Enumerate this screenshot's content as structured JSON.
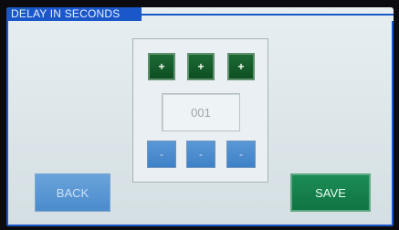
{
  "title": "DELAY IN SECONDS",
  "value_display": "001",
  "increment_buttons": [
    "+",
    "+",
    "+"
  ],
  "decrement_buttons": [
    "-",
    "-",
    "-"
  ],
  "actions": {
    "back_label": "BACK",
    "save_label": "SAVE"
  },
  "colors": {
    "title_bar": "#1a57c8",
    "increment": "#0e4f22",
    "decrement": "#4b8bcc",
    "back": "#4b8bcc",
    "save": "#0f7443",
    "background": "#e6eef1"
  }
}
